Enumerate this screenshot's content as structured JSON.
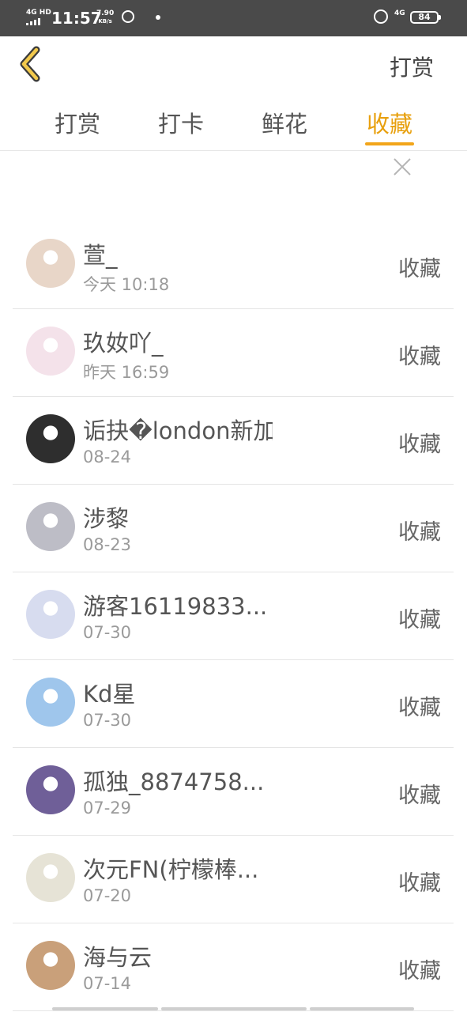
{
  "status": {
    "signal": "4G HD",
    "time": "11:57",
    "speed_value": "7.90",
    "speed_unit": "KB/s",
    "net": "4G",
    "battery": "84"
  },
  "header": {
    "back_icon": "chevron-left-icon",
    "title": "打赏"
  },
  "tabs": [
    {
      "label": "打赏"
    },
    {
      "label": "打卡"
    },
    {
      "label": "鲜花"
    },
    {
      "label": "收藏",
      "active": true
    }
  ],
  "accent_color": "#f2a51a",
  "close_icon": "close-icon",
  "items": [
    {
      "name": "萱_",
      "time": "今天 10:18",
      "action": "收藏",
      "avatar_color": "#e8d6c8"
    },
    {
      "name": "玖奻吖_",
      "time": "昨天 16:59",
      "action": "收藏",
      "avatar_color": "#f4e2ea"
    },
    {
      "name": "诟抉�london新加坡",
      "time": "08-24",
      "action": "收藏",
      "avatar_color": "#2e2e2e"
    },
    {
      "name": "涉黎",
      "time": "08-23",
      "action": "收藏",
      "avatar_color": "#bdbdc6"
    },
    {
      "name": "游客16119833...",
      "time": "07-30",
      "action": "收藏",
      "avatar_color": "#d7dcef"
    },
    {
      "name": "Kd星",
      "time": "07-30",
      "action": "收藏",
      "avatar_color": "#9fc6ec"
    },
    {
      "name": "孤独_8874758...",
      "time": "07-29",
      "action": "收藏",
      "avatar_color": "#6f5f98"
    },
    {
      "name": "次元FN(柠檬棒...",
      "time": "07-20",
      "action": "收藏",
      "avatar_color": "#e6e3d6"
    },
    {
      "name": "海与云",
      "time": "07-14",
      "action": "收藏",
      "avatar_color": "#c9a07a"
    }
  ]
}
